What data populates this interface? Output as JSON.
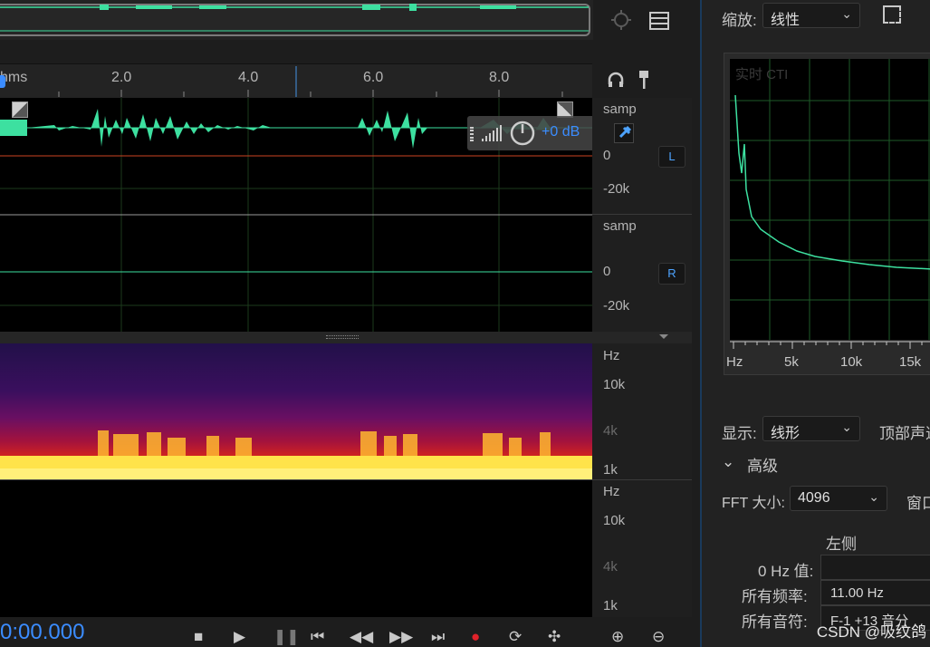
{
  "ruler": {
    "unit_label": "hms",
    "ticks": [
      "2.0",
      "4.0",
      "6.0",
      "8.0"
    ]
  },
  "waveform": {
    "left": {
      "scale_top": "samp",
      "scale_zero": "0",
      "scale_minus": "-20k",
      "channel_button": "L"
    },
    "right": {
      "scale_top": "samp",
      "scale_zero": "0",
      "scale_minus": "-20k",
      "channel_button": "R"
    },
    "gain_readout": "+0 dB"
  },
  "spectral": {
    "top": {
      "unit": "Hz",
      "tick_high": "10k",
      "tick_mid": "4k",
      "tick_low": "1k"
    },
    "bottom": {
      "unit": "Hz",
      "tick_high": "10k",
      "tick_mid": "4k",
      "tick_low": "1k"
    }
  },
  "transport": {
    "timecode": "0:00.000"
  },
  "right_panel": {
    "zoom_label": "缩放:",
    "zoom_value": "线性",
    "graph_overlay_text": "实时 CTI",
    "x_axis_ticks": [
      "Hz",
      "5k",
      "10k",
      "15k"
    ],
    "display_label": "显示:",
    "display_value": "线形",
    "top_channel_label": "顶部声道",
    "advanced_label": "高级",
    "fft_label": "FFT 大小:",
    "fft_value": "4096",
    "window_label": "窗口",
    "column_left_header": "左侧",
    "hz0_label": "0 Hz 值:",
    "hz0_value": "",
    "freq_label": "所有频率:",
    "freq_value": "11.00 Hz",
    "note_label": "所有音符:",
    "note_value": "F-1 +13 音分"
  },
  "watermark": "CSDN @吸纹鸽",
  "colors": {
    "wave": "#3de0a0",
    "accent": "#3b8cff",
    "record": "#e0222a",
    "graph_line": "#3de0a0",
    "grid": "#1e5a28"
  }
}
